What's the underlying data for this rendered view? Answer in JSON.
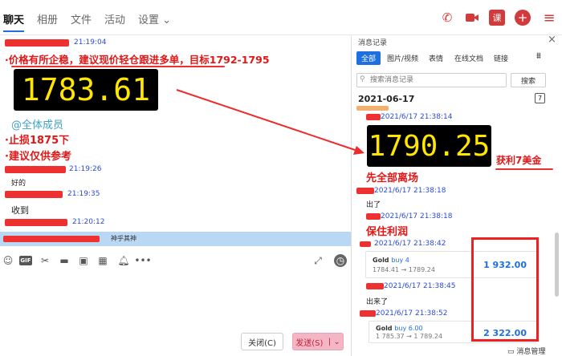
{
  "nav": {
    "chat": "聊天",
    "album": "相册",
    "files": "文件",
    "activity": "活动",
    "settings": "设置"
  },
  "top_icons": {
    "phone": "phone-icon",
    "video": "video-icon",
    "lesson": "课",
    "plus": "plus-icon",
    "more": "more-icon"
  },
  "left": {
    "t1": "21:19:04",
    "line1": "·价格有所企稳，建议现价轻仓跟进多单，目标1792-1795",
    "price1": "1783.61",
    "mention": "@全体成员",
    "stop": "·止损1875下",
    "advice": "·建议仅供参考",
    "t2": "21:19:26",
    "m2": "好的",
    "t3": "21:19:35",
    "m3": "收到",
    "t4": "21:20:12",
    "reply_text": "神乎其神"
  },
  "buttons": {
    "close": "关闭(C)",
    "send": "发送(S)"
  },
  "right": {
    "title": "消息记录",
    "tabs": [
      "全部",
      "图片/视频",
      "表情",
      "在线文档",
      "链接"
    ],
    "search_placeholder": "搜索消息记录",
    "search_btn": "搜索",
    "date": "2021-06-17",
    "t1": "2021/6/17 21:38:14",
    "price2": "1790.25",
    "profit": "获利7美金",
    "exit": "先全部离场",
    "t2": "2021/6/17 21:38:18",
    "m2": "出了",
    "t3": "2021/6/17 21:38:18",
    "keep": "保住利润",
    "t4": "2021/6/17 21:38:42",
    "card1": {
      "sym": "Gold",
      "dir": "buy 4",
      "prices": "1784.41 → 1789.24",
      "amount": "1 932.00"
    },
    "t5": "2021/6/17 21:38:45",
    "m5": "出来了",
    "t6": "2021/6/17 21:38:52",
    "card2": {
      "sym": "Gold",
      "dir": "buy 6.00",
      "prices": "1 785.37 → 1 789.24",
      "amount": "2 322.00"
    },
    "manage": "消息管理",
    "cal": "7"
  }
}
